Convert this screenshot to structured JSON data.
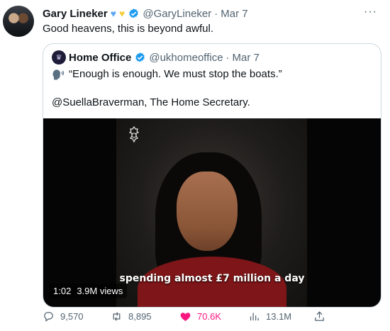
{
  "tweet": {
    "author_name": "Gary Lineker",
    "handle": "@GaryLineker",
    "separator": "·",
    "date": "Mar 7",
    "text": "Good heavens, this is beyond awful.",
    "more": "···"
  },
  "quoted": {
    "author_name": "Home Office",
    "handle": "@ukhomeoffice",
    "separator": "·",
    "date": "Mar 7",
    "line1": "“Enough is enough. We must stop the boats.”",
    "line2": "@SuellaBraverman, The Home Secretary.",
    "video": {
      "caption": "spending almost £7 million a day",
      "duration": "1:02",
      "views": "3.9M views"
    }
  },
  "actions": {
    "replies": "9,570",
    "retweets": "8,895",
    "likes": "70.6K",
    "views": "13.1M"
  },
  "colors": {
    "verified": "#1d9bf0",
    "like": "#f91880",
    "muted": "#536471"
  }
}
